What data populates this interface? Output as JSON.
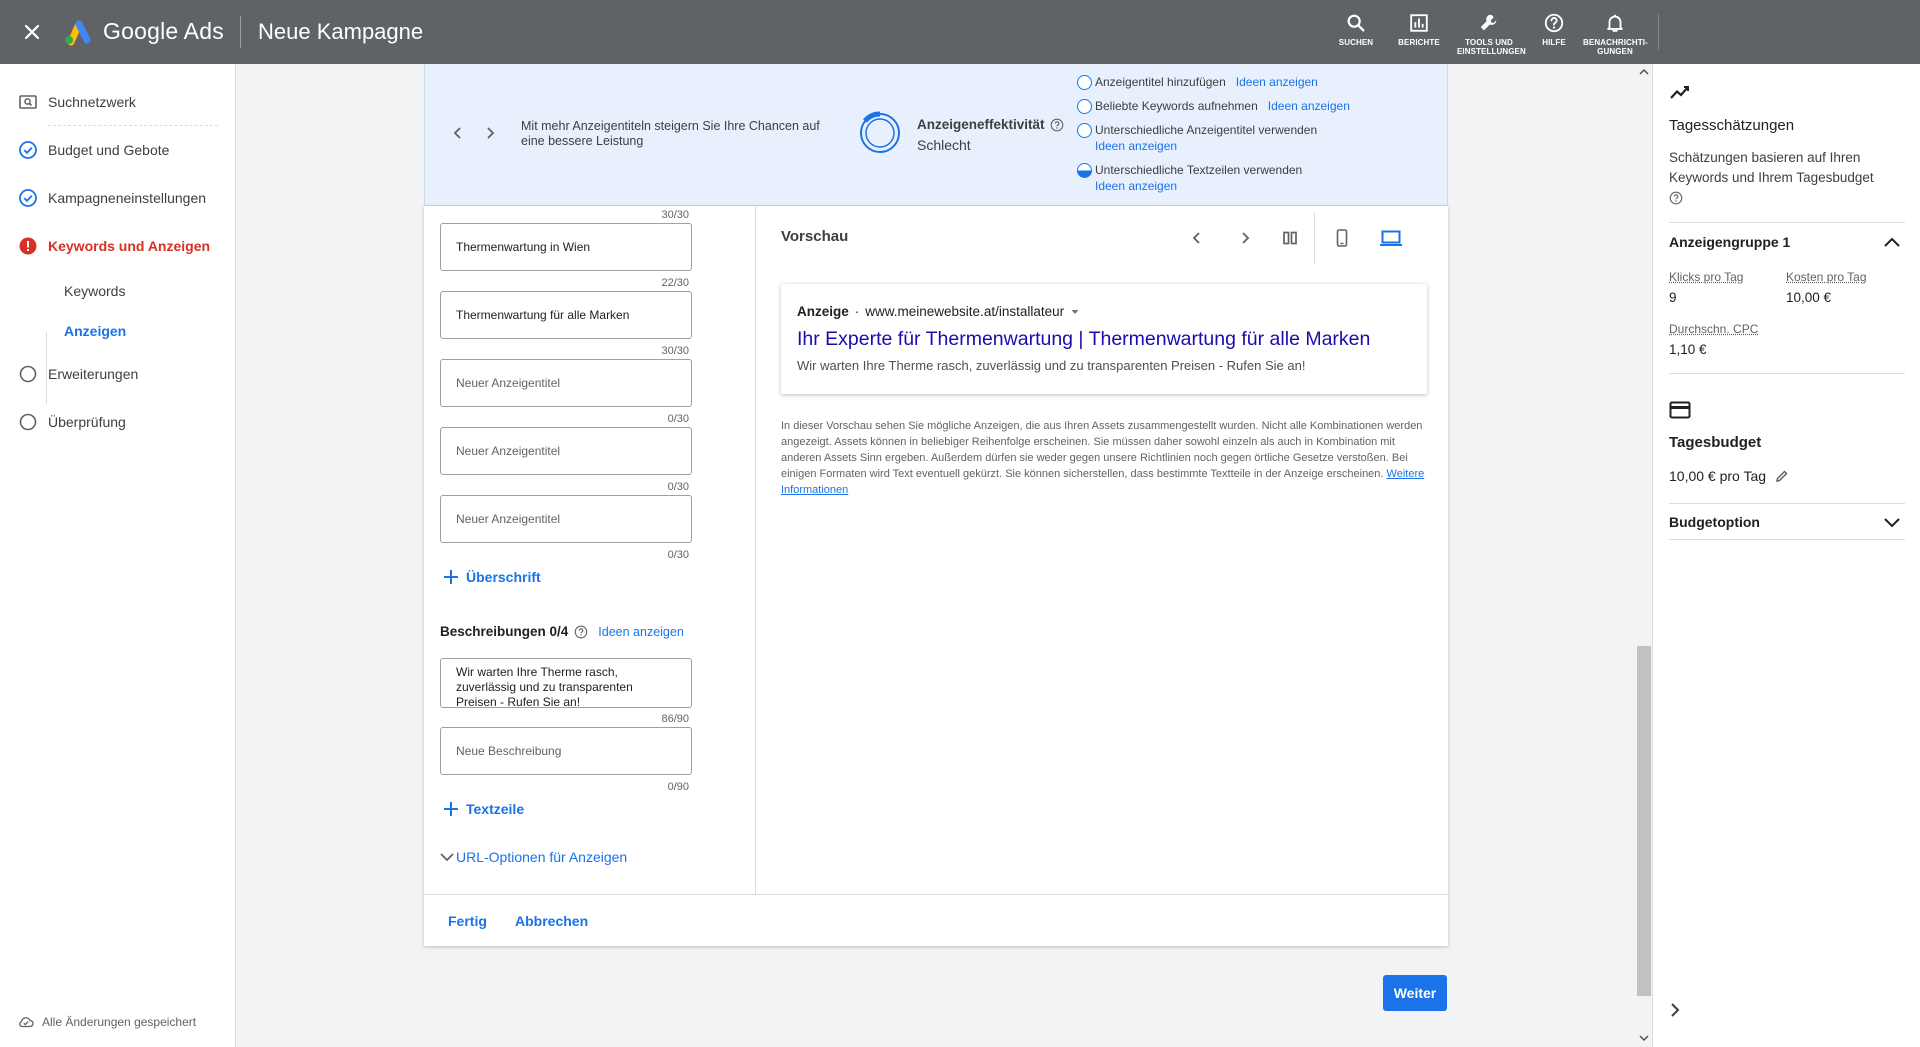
{
  "topbar": {
    "brand": "Google Ads",
    "title": "Neue Kampagne",
    "actions": [
      {
        "icon": "search-icon",
        "label": "SUCHEN"
      },
      {
        "icon": "reports-icon",
        "label": "BERICHTE"
      },
      {
        "icon": "tools-icon",
        "label_line1": "TOOLS UND",
        "label_line2": "EINSTELLUNGEN"
      },
      {
        "icon": "help-icon",
        "label": "HILFE"
      },
      {
        "icon": "bell-icon",
        "label_line1": "BENACHRICHTI-",
        "label_line2": "GUNGEN"
      }
    ]
  },
  "sidebar": {
    "items": [
      {
        "label": "Suchnetzwerk",
        "icon": "search-network-icon",
        "status": "none"
      },
      {
        "label": "Budget und Gebote",
        "icon": "check-circle-icon",
        "status": "done"
      },
      {
        "label": "Kampagneneinstellungen",
        "icon": "check-circle-icon",
        "status": "done"
      },
      {
        "label": "Keywords und Anzeigen",
        "icon": "error-icon",
        "status": "error"
      },
      {
        "label": "Erweiterungen",
        "icon": "empty-circle-icon",
        "status": "todo"
      },
      {
        "label": "Überprüfung",
        "icon": "empty-circle-icon",
        "status": "todo"
      }
    ],
    "subitems": [
      {
        "label": "Keywords"
      },
      {
        "label": "Anzeigen",
        "active": true
      }
    ],
    "saved_status": "Alle Änderungen gespeichert"
  },
  "banner": {
    "message": "Mit mehr Anzeigentiteln steigern Sie Ihre Chancen auf eine bessere Leistung",
    "effectiveness_label": "Anzeigeneffektivität",
    "effectiveness_value": "Schlecht",
    "tips": [
      {
        "text": "Anzeigentitel hinzufügen",
        "link": "Ideen anzeigen"
      },
      {
        "text": "Beliebte Keywords aufnehmen",
        "link": "Ideen anzeigen"
      },
      {
        "text": "Unterschiedliche Anzeigentitel verwenden",
        "link": "Ideen anzeigen"
      },
      {
        "text": "Unterschiedliche Textzeilen verwenden",
        "link": "Ideen anzeigen"
      }
    ]
  },
  "editor": {
    "top_counter": "30/30",
    "headlines": [
      {
        "value": "Thermenwartung in Wien",
        "counter": "22/30"
      },
      {
        "value": "Thermenwartung für alle Marken",
        "counter": "30/30"
      },
      {
        "placeholder": "Neuer Anzeigentitel",
        "counter": "0/30"
      },
      {
        "placeholder": "Neuer Anzeigentitel",
        "counter": "0/30"
      },
      {
        "placeholder": "Neuer Anzeigentitel",
        "counter": "0/30"
      }
    ],
    "add_headline": "Überschrift",
    "descriptions_title": "Beschreibungen 0/4",
    "descriptions_link": "Ideen anzeigen",
    "descriptions": [
      {
        "value": "Wir warten Ihre Therme rasch, zuverlässig und zu transparenten Preisen - Rufen Sie an!",
        "counter": "86/90"
      },
      {
        "placeholder": "Neue Beschreibung",
        "counter": "0/90"
      }
    ],
    "add_description": "Textzeile",
    "url_options": "URL-Optionen für Anzeigen"
  },
  "preview": {
    "title": "Vorschau",
    "ad_label": "Anzeige",
    "ad_url": "www.meinewebsite.at/installateur",
    "ad_headline": "Ihr Experte für Thermenwartung | Thermenwartung für alle Marken",
    "ad_description": "Wir warten Ihre Therme rasch, zuverlässig und zu transparenten Preisen - Rufen Sie an!",
    "note": "In dieser Vorschau sehen Sie mögliche Anzeigen, die aus Ihren Assets zusammengestellt wurden. Nicht alle Kombinationen werden angezeigt. Assets können in beliebiger Reihenfolge erscheinen. Sie müssen daher sowohl einzeln als auch in Kombination mit anderen Assets Sinn ergeben. Außerdem dürfen sie weder gegen unsere Richtlinien noch gegen örtliche Gesetze verstoßen. Bei einigen Formaten wird Text eventuell gekürzt. Sie können sicherstellen, dass bestimmte Textteile in der Anzeige erscheinen.",
    "note_link": "Weitere Informationen"
  },
  "footer": {
    "done": "Fertig",
    "cancel": "Abbrechen",
    "next": "Weiter"
  },
  "rightpanel": {
    "title": "Tagesschätzungen",
    "description": "Schätzungen basieren auf Ihren Keywords und Ihrem Tagesbudget",
    "group": "Anzeigengruppe 1",
    "clicks_label": "Klicks pro Tag",
    "clicks_value": "9",
    "cost_label": "Kosten pro Tag",
    "cost_value": "10,00 €",
    "cpc_label": "Durchschn. CPC",
    "cpc_value": "1,10 €",
    "budget_title": "Tagesbudget",
    "budget_value": "10,00 € pro Tag",
    "budget_option": "Budgetoption"
  },
  "colors": {
    "topbar": "#5f6368",
    "accent": "#1a73e8",
    "error": "#d93025",
    "banner": "#e8f0fe",
    "ad_headline": "#1a0dab"
  }
}
